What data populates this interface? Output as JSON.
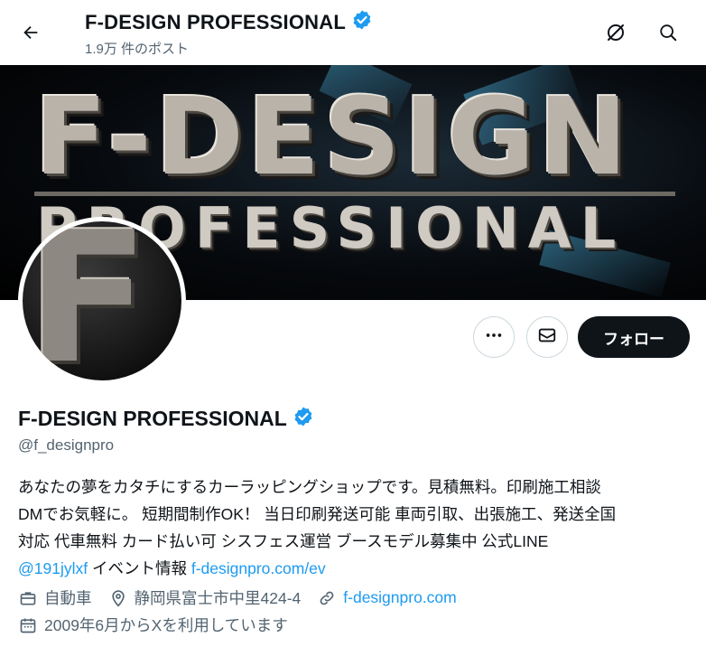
{
  "header": {
    "title": "F-DESIGN PROFESSIONAL",
    "post_count": "1.9万 件のポスト",
    "back_icon": "arrow-left-icon",
    "grok_icon": "grok-icon",
    "search_icon": "search-icon"
  },
  "banner": {
    "big_text": "F-DESIGN",
    "small_text": "PROFESSIONAL"
  },
  "avatar": {
    "letter": "F"
  },
  "actions": {
    "more_icon": "more-dots-icon",
    "message_icon": "envelope-icon",
    "follow_label": "フォロー"
  },
  "profile": {
    "name": "F-DESIGN PROFESSIONAL",
    "handle": "@f_designpro",
    "bio_line1": "あなたの夢をカタチにするカーラッピングショップです。見積無料。印刷施工相談",
    "bio_line2": "DMでお気軽に。 短期間制作OK！ 当日印刷発送可能 車両引取、出張施工、発送全国",
    "bio_line3": "対応 代車無料 カード払い可 シスフェス運営 ブースモデル募集中 公式LINE",
    "bio_mention": "@191jylxf",
    "bio_event": " イベント情報 ",
    "bio_link": "f-designpro.com/ev"
  },
  "meta": {
    "category": "自動車",
    "location": "静岡県富士市中里424-4",
    "website": "f-designpro.com",
    "joined": "2009年6月からXを利用しています"
  },
  "colors": {
    "verified_blue": "#1d9bf0",
    "text_primary": "#0f1419",
    "text_secondary": "#536471",
    "link": "#1d9bf0",
    "follow_bg": "#0f1419"
  }
}
